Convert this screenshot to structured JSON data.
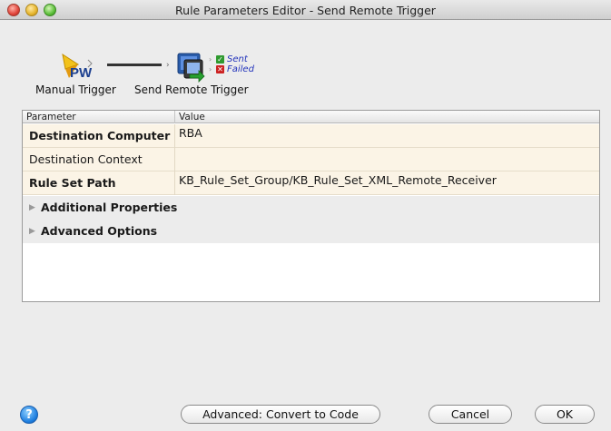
{
  "window": {
    "title": "Rule Parameters Editor - Send Remote Trigger"
  },
  "flow": {
    "source_label": "Manual Trigger",
    "target_label": "Send Remote Trigger",
    "source_icon": "pw-trigger-icon",
    "target_icon": "remote-computer-icon",
    "outputs": [
      {
        "label": "Sent",
        "status": "success",
        "color": "#2f9a2f"
      },
      {
        "label": "Failed",
        "status": "error",
        "color": "#cc2222"
      }
    ]
  },
  "table": {
    "columns": [
      "Parameter",
      "Value"
    ],
    "rows": [
      {
        "parameter": "Destination Computer",
        "value": "RBA",
        "required": true
      },
      {
        "parameter": "Destination Context",
        "value": "",
        "required": false
      },
      {
        "parameter": "Rule Set Path",
        "value": "KB_Rule_Set_Group/KB_Rule_Set_XML_Remote_Receiver",
        "required": true
      }
    ],
    "groups": [
      {
        "label": "Additional Properties",
        "expanded": false
      },
      {
        "label": "Advanced Options",
        "expanded": false
      }
    ]
  },
  "buttons": {
    "help": "?",
    "convert": "Advanced: Convert to Code",
    "cancel": "Cancel",
    "ok": "OK"
  }
}
